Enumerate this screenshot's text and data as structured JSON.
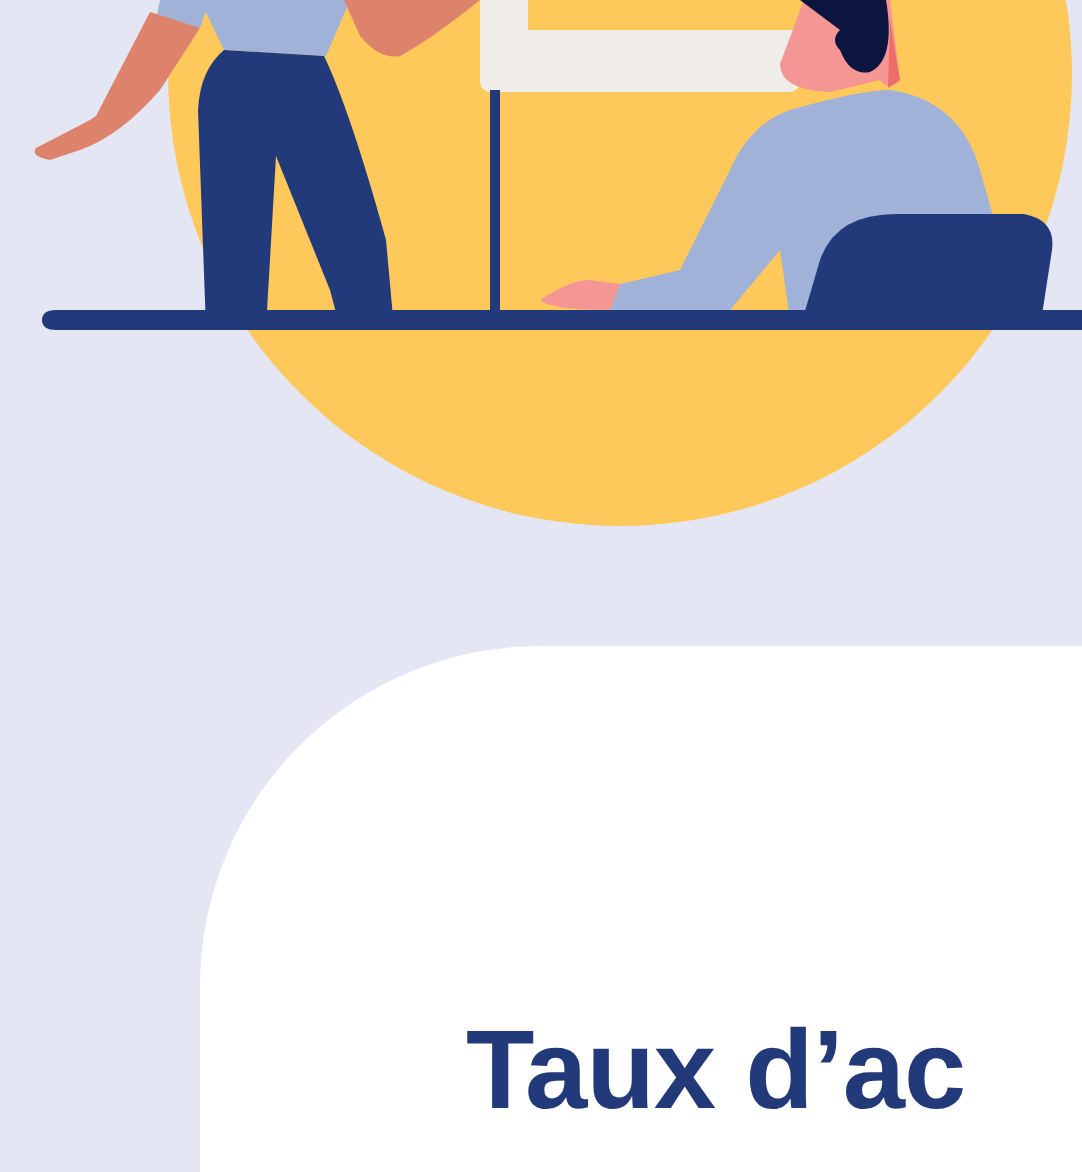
{
  "card": {
    "heading": "Taux d’ac"
  }
}
